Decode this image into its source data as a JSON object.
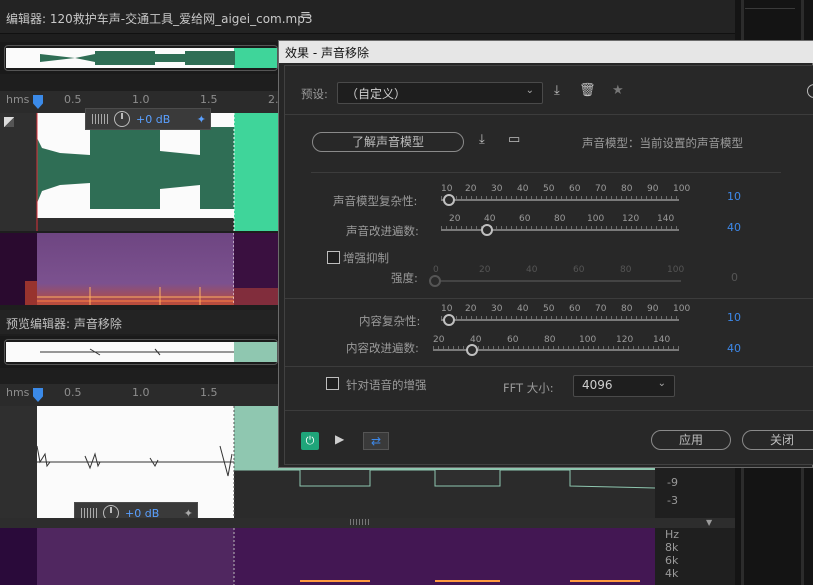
{
  "editor": {
    "title": "编辑器: 120救护车声-交通工具_爱给网_aigei_com.mp3",
    "menu_icon": "hamburger-icon"
  },
  "preview": {
    "title": "预览编辑器: 声音移除"
  },
  "ruler": {
    "unit": "hms",
    "ticks": [
      "0.5",
      "1.0",
      "1.5",
      "2."
    ]
  },
  "hud": {
    "volume": "+0 dB"
  },
  "db_scale": [
    "-9",
    "-3"
  ],
  "hz_scale": [
    "Hz",
    "8k",
    "6k",
    "4k"
  ],
  "dialog": {
    "title": "效果 - 声音移除",
    "preset_label": "预设:",
    "preset_value": "（自定义）",
    "learn_button": "了解声音模型",
    "model_status": "声音模型：当前设置的声音模型",
    "sliders": {
      "model_complexity": {
        "label": "声音模型复杂性:",
        "scale": [
          "10",
          "20",
          "30",
          "40",
          "50",
          "60",
          "70",
          "80",
          "90",
          "100"
        ],
        "value": "10",
        "fraction": 0.0
      },
      "model_passes": {
        "label": "声音改进遍数:",
        "scale": [
          "20",
          "40",
          "60",
          "80",
          "100",
          "120",
          "140"
        ],
        "value": "40",
        "fraction": 0.16
      },
      "enhance_strength": {
        "label": "强度:",
        "scale": [
          "0",
          "20",
          "40",
          "60",
          "80",
          "100"
        ],
        "value": "0",
        "fraction": 0.0,
        "disabled": true
      },
      "content_complexity": {
        "label": "内容复杂性:",
        "scale": [
          "10",
          "20",
          "30",
          "40",
          "50",
          "60",
          "70",
          "80",
          "90",
          "100"
        ],
        "value": "10",
        "fraction": 0.0
      },
      "content_passes": {
        "label": "内容改进遍数:",
        "scale": [
          "20",
          "40",
          "60",
          "80",
          "100",
          "120",
          "140"
        ],
        "value": "40",
        "fraction": 0.16
      }
    },
    "enhance_suppress": "增强抑制",
    "speech_enhance": "针对语音的增强",
    "fft_label": "FFT 大小:",
    "fft_value": "4096",
    "apply_button": "应用",
    "close_button": "关闭",
    "colors": {
      "accent": "#3d88e8",
      "power": "#1fa57a"
    }
  },
  "colors": {
    "waveform": "#3fd59a",
    "waveform_dim": "#4a8a70",
    "spectral": "#6a3a7a"
  }
}
